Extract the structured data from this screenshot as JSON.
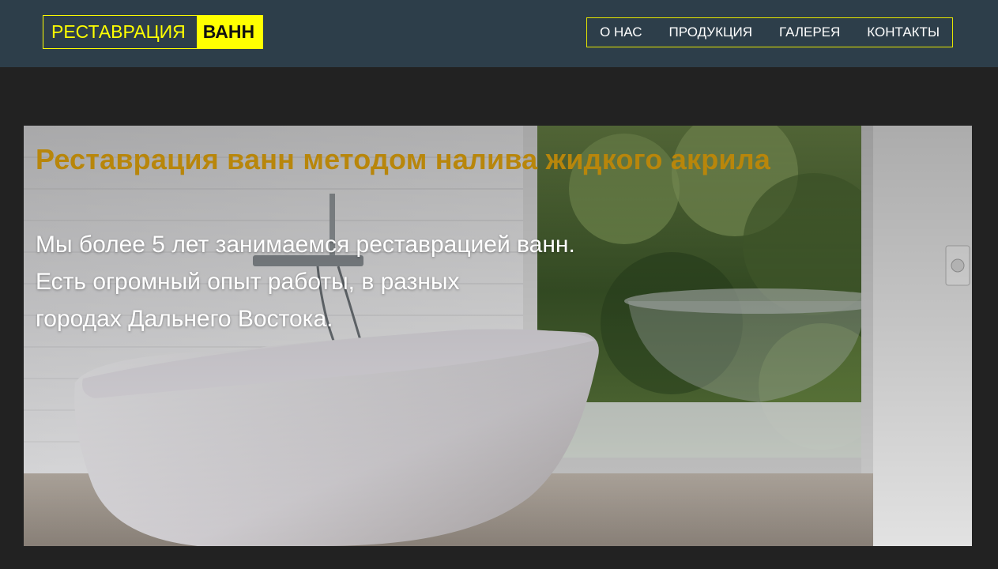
{
  "header": {
    "logo_part1": "РЕСТАВРАЦИЯ",
    "logo_part2": "ВАНН",
    "nav": [
      {
        "label": "О НАС"
      },
      {
        "label": "ПРОДУКЦИЯ"
      },
      {
        "label": "ГАЛЕРЕЯ"
      },
      {
        "label": "КОНТАКТЫ"
      }
    ]
  },
  "hero": {
    "title": "Реставрация ванн методом налива жидкого акрила",
    "lines": [
      "Мы более 5 лет занимаемся реставрацией ванн.",
      "Есть огромный опыт работы, в разных",
      "городах Дальнего Востока."
    ]
  },
  "colors": {
    "header_bg": "#2d3e4a",
    "page_bg": "#222222",
    "accent_yellow": "#ffff00",
    "title_gold": "#b8860b"
  }
}
